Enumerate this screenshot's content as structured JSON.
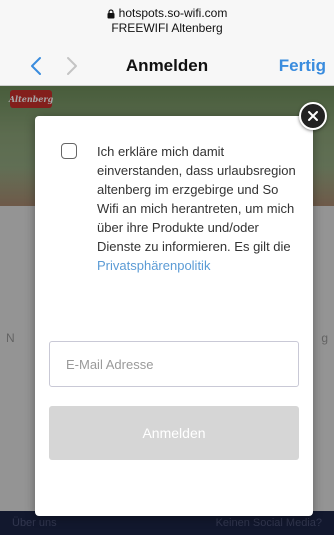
{
  "browser": {
    "url": "hotspots.so-wifi.com",
    "site_title": "FREEWIFI Altenberg",
    "page_title": "Anmelden",
    "done_label": "Fertig",
    "accent_color": "#3a8cde"
  },
  "background": {
    "logo_text": "Altenberg",
    "left_fragment": "N",
    "right_fragment": "g",
    "footer_left": "Über uns",
    "footer_right": "Keinen Social Media?"
  },
  "modal": {
    "consent_text": "Ich erkläre mich damit einverstanden, dass urlaubsregion altenberg im erzgebirge und So Wifi an mich herantreten, um mich über ihre Produkte und/oder Dienste zu informieren. Es gilt die",
    "privacy_link": "Privatsphärenpolitik",
    "email_placeholder": "E-Mail Adresse",
    "email_value": "",
    "submit_label": "Anmelden",
    "checkbox_checked": false
  },
  "icons": {
    "lock": "lock-icon",
    "back": "chevron-left-icon",
    "forward": "chevron-right-icon",
    "close": "close-icon"
  }
}
